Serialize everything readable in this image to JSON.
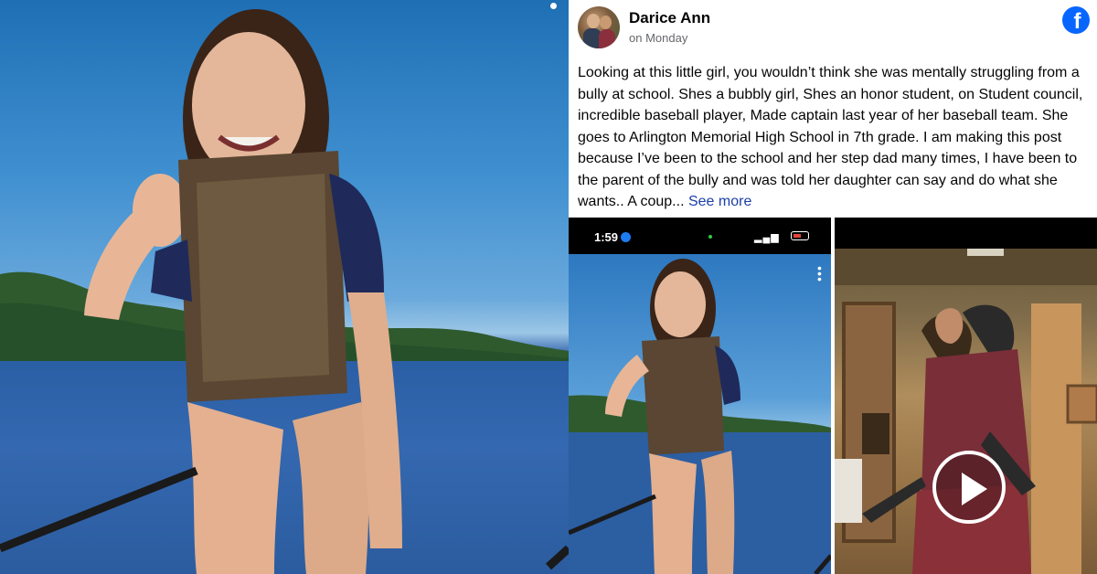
{
  "post": {
    "author": "Darice Ann",
    "timestamp": "on Monday",
    "text": "Looking at this little girl, you wouldn’t think she was mentally struggling from a bully at school. Shes a bubbly girl, Shes an honor student, on Student council, incredible baseball player, Made captain last year of her baseball team. She goes to Arlington Memorial High School in 7th grade. I am making this post because I’ve been to the school and her step dad many times, I have been to the parent of the bully and was told her daughter can say and do what she wants.. A coup...",
    "see_more": "See more",
    "platform_icon": "facebook-icon"
  },
  "thumbnails": {
    "screenshot_clock": "1:59",
    "video_control": "play-icon"
  },
  "colors": {
    "facebook_blue": "#0866ff",
    "link_blue": "#1a3fa8",
    "text": "#050505",
    "muted": "#65676b"
  }
}
